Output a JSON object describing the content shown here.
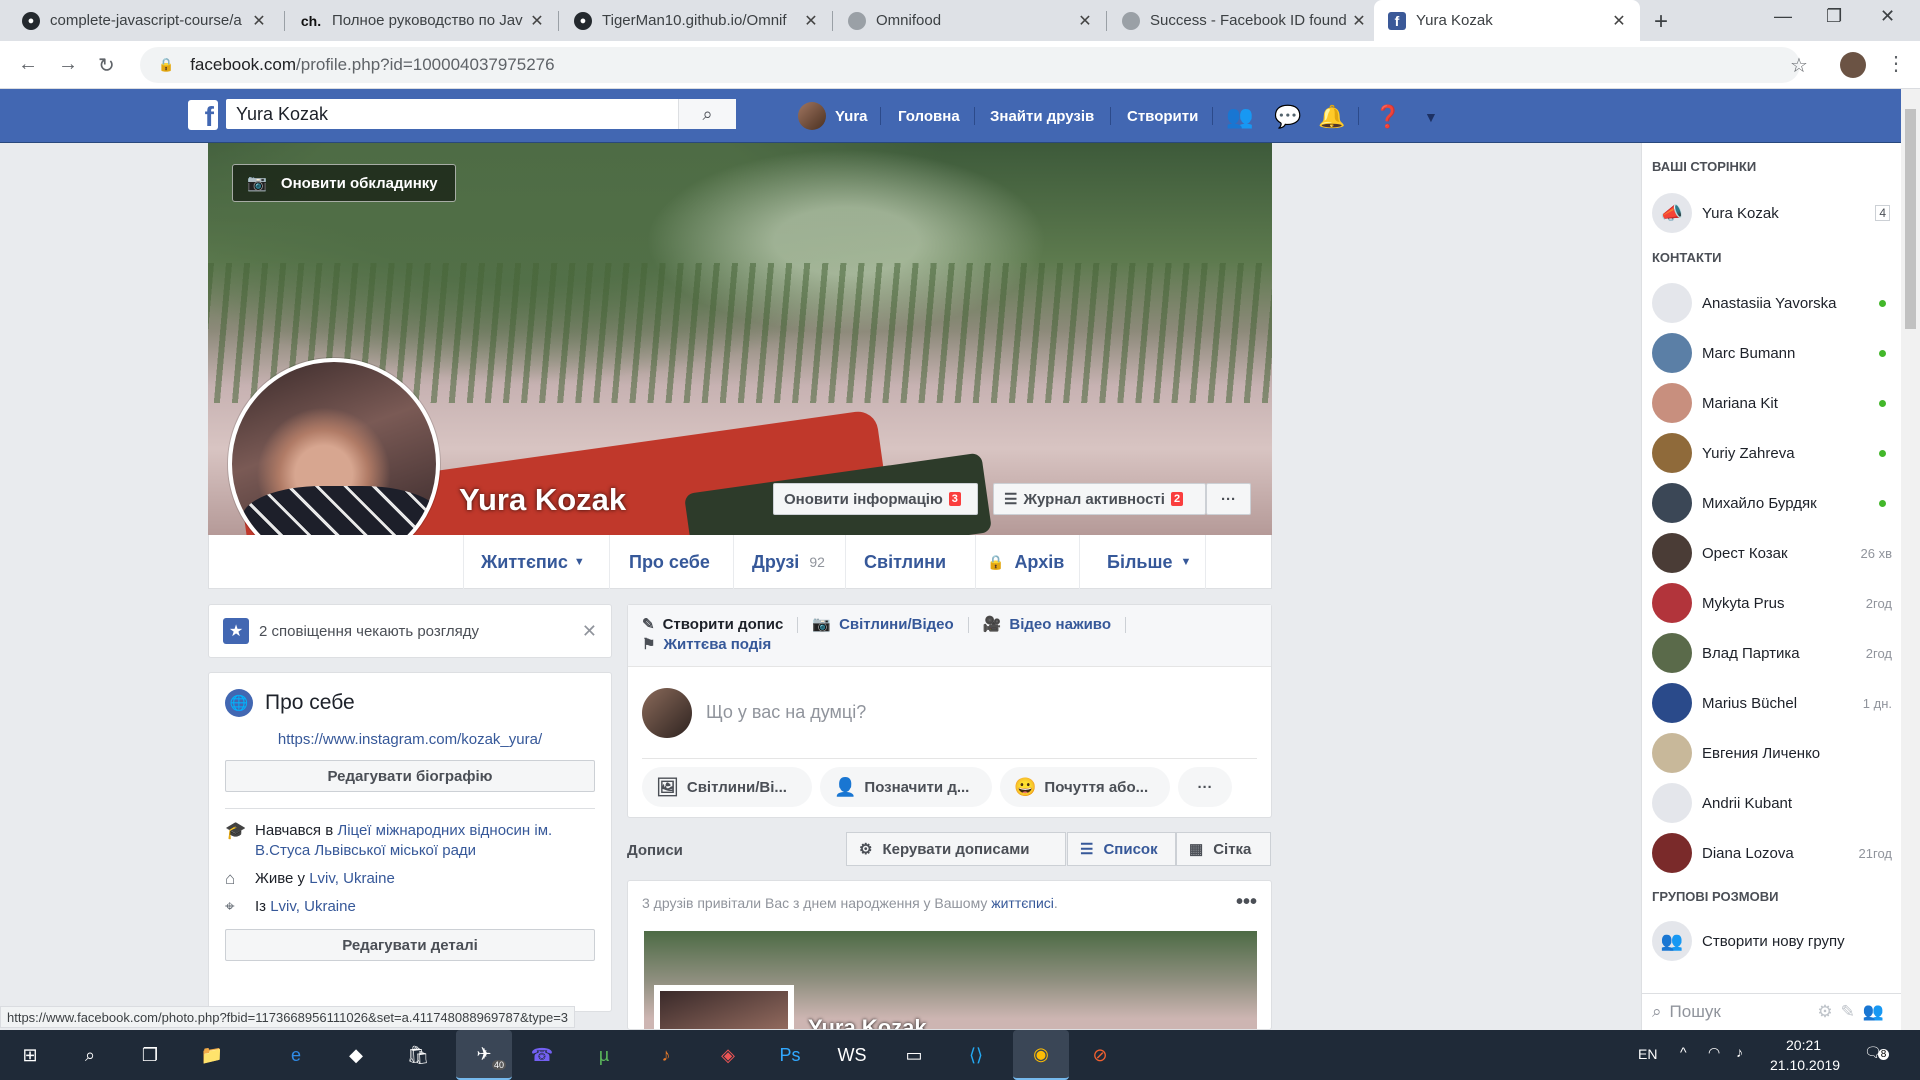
{
  "browser": {
    "tabs": [
      {
        "title": "complete-javascript-course/a",
        "icon": "github-icon"
      },
      {
        "title": "Полное руководство по Jav",
        "icon": "ch-favicon",
        "favicon_text": "ch."
      },
      {
        "title": "TigerMan10.github.io/Omnif",
        "icon": "github-icon"
      },
      {
        "title": "Omnifood",
        "icon": "globe-icon"
      },
      {
        "title": "Success - Facebook ID found",
        "icon": "globe-icon"
      },
      {
        "title": "Yura Kozak",
        "icon": "facebook-icon",
        "active": true
      }
    ],
    "url_host": "facebook.com",
    "url_path": "/profile.php?id=100004037975276",
    "status_url": "https://www.facebook.com/photo.php?fbid=1173668956111026&set=a.411748088969787&type=3"
  },
  "fbbar": {
    "logo": "f",
    "search_value": "Yura Kozak",
    "user": "Yura",
    "nav": [
      "Головна",
      "Знайти друзів",
      "Створити"
    ]
  },
  "profile": {
    "name": "Yura Kozak",
    "update_cover": "Оновити обкладинку",
    "update_info": "Оновити інформацію",
    "update_info_badge": "3",
    "activity_log": "Журнал активності",
    "activity_log_badge": "2",
    "more_dots": "···",
    "tabs": [
      {
        "label": "Життєпис",
        "suffix": "▼"
      },
      {
        "label": "Про себе"
      },
      {
        "label": "Друзі",
        "count": "92"
      },
      {
        "label": "Світлини"
      },
      {
        "label": "Архів",
        "prefix": "🔒"
      },
      {
        "label": "Більше",
        "suffix": "▼"
      }
    ]
  },
  "notifications": {
    "text": "2 сповіщення чекають розгляду"
  },
  "about": {
    "title": "Про себе",
    "link": "https://www.instagram.com/kozak_yura/",
    "edit_bio": "Редагувати біографію",
    "studied_prefix": "Навчався в",
    "studied_place": "Ліцеї міжнародних відносин ім. В.Стуса Львівської міської ради",
    "lives_prefix": "Живе у",
    "lives_place": "Lviv, Ukraine",
    "from_prefix": "Із",
    "from_place": "Lviv, Ukraine",
    "edit_details": "Редагувати деталі"
  },
  "composer": {
    "tab_create": "Створити допис",
    "tab_photo": "Світлини/Відео",
    "tab_live": "Відео наживо",
    "tab_event": "Життєва подія",
    "placeholder": "Що у вас на думці?",
    "pill_photo": "Світлини/Ві...",
    "pill_tag": "Позначити д...",
    "pill_feeling": "Почуття або...",
    "pill_more": "···"
  },
  "posts": {
    "label": "Дописи",
    "manage": "Керувати дописами",
    "list": "Список",
    "grid": "Сітка",
    "feed_text": "3 друзів привітали Вас з днем народження у Вашому",
    "feed_link": "життєписі",
    "feed_dot": ".",
    "feed_name": "Yura Kozak",
    "feed_dots": "•••"
  },
  "sidebar": {
    "your_pages": "ВАШІ СТОРІНКИ",
    "page": {
      "name": "Yura Kozak",
      "count": "4"
    },
    "contacts_title": "КОНТАКТИ",
    "contacts": [
      {
        "name": "Anastasiia Yavorska",
        "status": "online",
        "color": "#e4e6eb"
      },
      {
        "name": "Marc Bumann",
        "status": "online",
        "color": "#5b7fa6"
      },
      {
        "name": "Mariana Kit",
        "status": "online",
        "color": "#c88f7e"
      },
      {
        "name": "Yuriy Zahreva",
        "status": "online",
        "color": "#8f6a3a"
      },
      {
        "name": "Михайло Бурдяк",
        "status": "online",
        "color": "#3b4756"
      },
      {
        "name": "Орест Козак",
        "meta": "26 хв",
        "color": "#4a3c36"
      },
      {
        "name": "Mykyta Prus",
        "meta": "2год",
        "color": "#b2343b"
      },
      {
        "name": "Влад Партика",
        "meta": "2год",
        "color": "#5a6a4a"
      },
      {
        "name": "Marius Büchel",
        "meta": "1 дн.",
        "color": "#2a4a8a"
      },
      {
        "name": "Евгения Личенко",
        "color": "#c8b89a"
      },
      {
        "name": "Andrii Kubant",
        "color": "#e4e6eb"
      },
      {
        "name": "Diana Lozova",
        "meta": "21год",
        "color": "#7a2a2a"
      }
    ],
    "group_title": "ГРУПОВІ РОЗМОВИ",
    "new_group": "Створити нову групу",
    "search_placeholder": "Пошук"
  },
  "taskbar": {
    "lang": "EN",
    "time": "20:21",
    "date": "21.10.2019",
    "telegram_badge": "40",
    "notif_badge": "8"
  }
}
